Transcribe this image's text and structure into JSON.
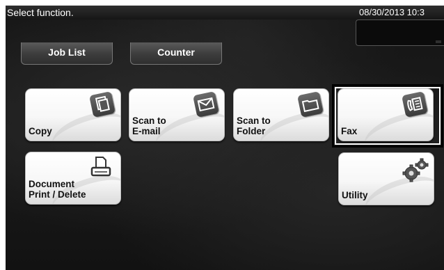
{
  "header": {
    "title": "Select function.",
    "datetime": "08/30/2013 10:3"
  },
  "tabs": {
    "job_list": "Job List",
    "counter": "Counter"
  },
  "functions": {
    "copy": "Copy",
    "scan_email": "Scan to\nE-mail",
    "scan_folder": "Scan to\nFolder",
    "fax": "Fax",
    "document": "Document\nPrint / Delete",
    "utility": "Utility"
  },
  "icons": {
    "copy": "copy-icon",
    "scan_email": "envelope-icon",
    "scan_folder": "folder-icon",
    "fax": "fax-icon",
    "document": "printer-icon",
    "utility": "gears-icon"
  },
  "selected_function": "fax",
  "colors": {
    "background": "#1a1a1a",
    "button_face": "#ffffff",
    "icon_tile": "#4a4a4a",
    "selection_frame": "#000000"
  }
}
